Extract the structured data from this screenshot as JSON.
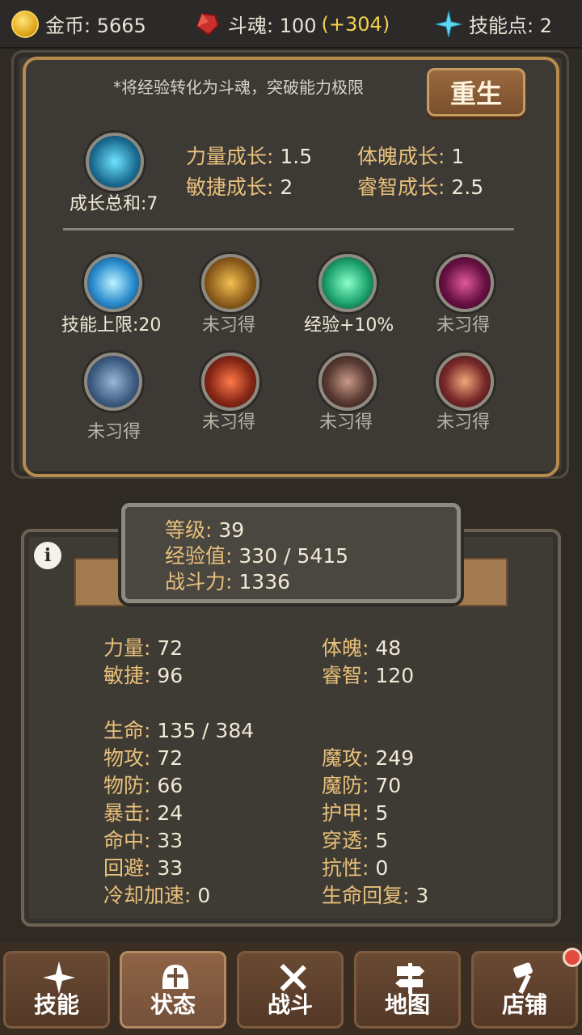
{
  "topbar": {
    "gold_label": "金币: 5665",
    "soul_label": "斗魂: 100",
    "soul_bonus": "(+304)",
    "skillpoint_label": "技能点: 2"
  },
  "growth_panel": {
    "hint": "*将经验转化为斗魂，突破能力极限",
    "rebirth_label": "重生",
    "total_label": "成长总和:7",
    "rows": [
      {
        "key": "力量成长:",
        "value": "1.5"
      },
      {
        "key": "体魄成长:",
        "value": "1"
      },
      {
        "key": "敏捷成长:",
        "value": "2"
      },
      {
        "key": "睿智成长:",
        "value": "2.5"
      }
    ]
  },
  "skills": [
    {
      "label": "技能上限:20",
      "icon": "shield-orb-icon",
      "learned": true
    },
    {
      "label": "未习得",
      "icon": "hand-glow-icon",
      "learned": false
    },
    {
      "label": "经验+10%",
      "icon": "wind-slash-icon",
      "learned": true
    },
    {
      "label": "未习得",
      "icon": "eye-vortex-icon",
      "learned": false
    },
    {
      "label": "未习得",
      "icon": "wind-sword-icon",
      "learned": false
    },
    {
      "label": "未习得",
      "icon": "fire-warrior-icon",
      "learned": false
    },
    {
      "label": "未习得",
      "icon": "horse-icon",
      "learned": false
    },
    {
      "label": "未习得",
      "icon": "firework-icon",
      "learned": false
    }
  ],
  "badge": {
    "level_key": "等级:",
    "level_value": "39",
    "exp_key": "经验值:",
    "exp_value": "330 / 5415",
    "power_key": "战斗力:",
    "power_value": "1336"
  },
  "stats": {
    "left_top": [
      {
        "key": "力量:",
        "value": "72"
      },
      {
        "key": "敏捷:",
        "value": "96"
      }
    ],
    "right_top": [
      {
        "key": "体魄:",
        "value": "48"
      },
      {
        "key": "睿智:",
        "value": "120"
      }
    ],
    "hp": {
      "key": "生命:",
      "value": "135 / 384"
    },
    "left": [
      {
        "key": "物攻:",
        "value": "72"
      },
      {
        "key": "物防:",
        "value": "66"
      },
      {
        "key": "暴击:",
        "value": "24"
      },
      {
        "key": "命中:",
        "value": "33"
      },
      {
        "key": "回避:",
        "value": "33"
      },
      {
        "key": "冷却加速:",
        "value": "0"
      }
    ],
    "right": [
      {
        "key": "魔攻:",
        "value": "249"
      },
      {
        "key": "魔防:",
        "value": "70"
      },
      {
        "key": "护甲:",
        "value": "5"
      },
      {
        "key": "穿透:",
        "value": "5"
      },
      {
        "key": "抗性:",
        "value": "0"
      },
      {
        "key": "生命回复:",
        "value": "3"
      }
    ]
  },
  "nav": [
    {
      "label": "技能",
      "icon": "sparkle-icon"
    },
    {
      "label": "状态",
      "icon": "helmet-icon"
    },
    {
      "label": "战斗",
      "icon": "crossed-swords-icon"
    },
    {
      "label": "地图",
      "icon": "signpost-icon"
    },
    {
      "label": "店铺",
      "icon": "hammer-icon"
    }
  ],
  "colors": {
    "accent_gold": "#f4d24a",
    "label_key": "#e8c07b",
    "frame_copper": "#b98a4d",
    "notification": "#e24a3c"
  }
}
